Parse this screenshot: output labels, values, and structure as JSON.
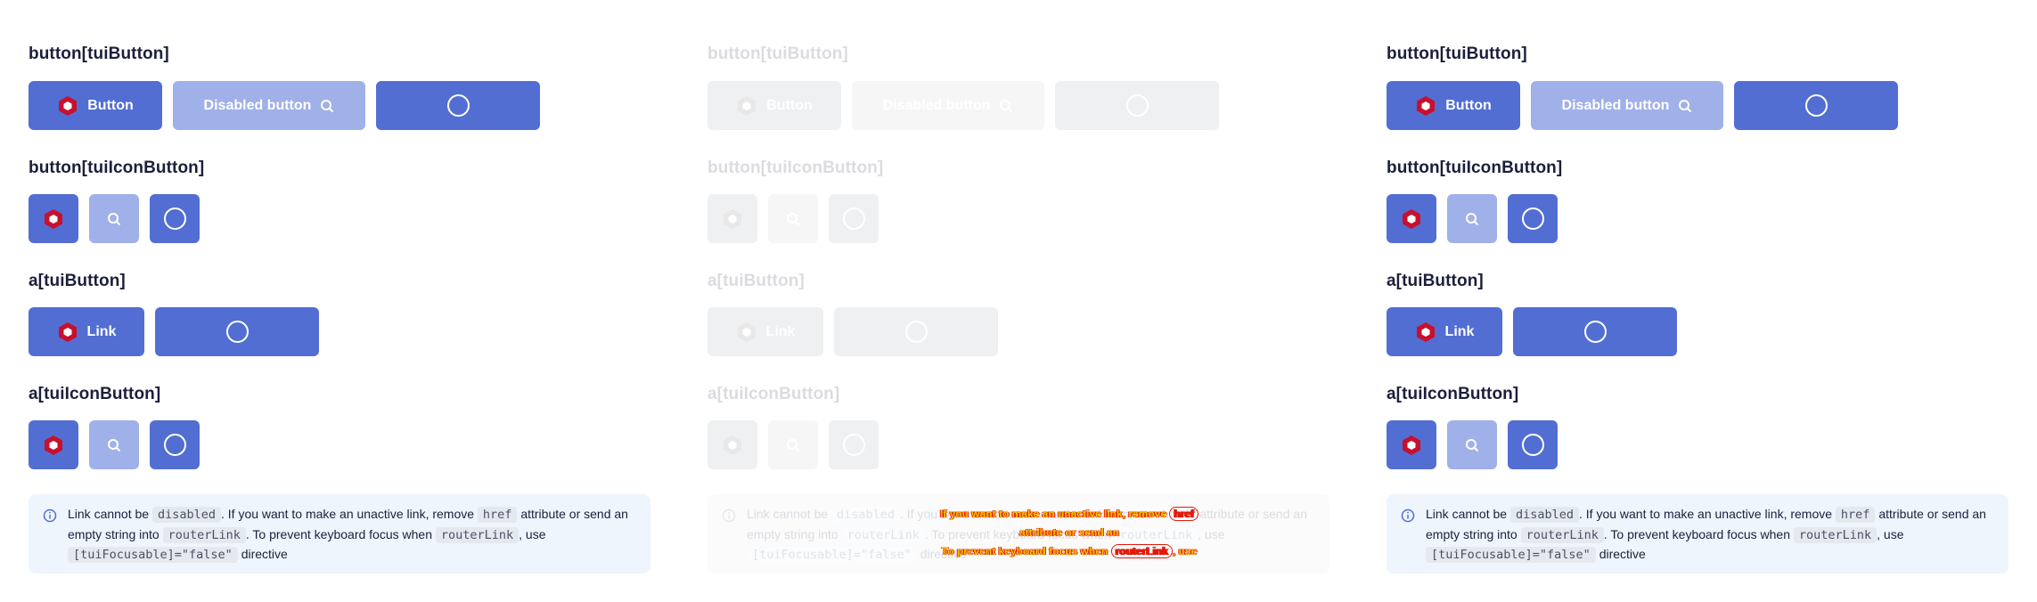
{
  "sections": {
    "button_tuiButton": "button[tuiButton]",
    "button_tuiIconButton": "button[tuiIconButton]",
    "a_tuiButton": "a[tuiButton]",
    "a_tuiIconButton": "a[tuiIconButton]"
  },
  "buttons": {
    "button_label": "Button",
    "disabled_label": "Disabled button",
    "link_label": "Link"
  },
  "notice": {
    "t1": "Link cannot be ",
    "c1": "disabled",
    "t2": ". If you want to make an unactive link, remove ",
    "c2": "href",
    "t3": " attribute or send an empty string into ",
    "c3": "routerLink",
    "t4": ". To prevent keyboard focus when ",
    "c4": "routerLink",
    "t5": ", use ",
    "c5": "[tuiFocusable]=\"false\"",
    "t6": " directive"
  },
  "overlay": {
    "line1": "If you want to make an unactive link, remove",
    "code1": "href",
    "line1b": "attribute or send an",
    "line2": "To prevent keyboard focus when",
    "code2": "routerLink",
    "line2b": ", use"
  },
  "colors": {
    "primary": "#526ed3",
    "primary_disabled": "#a0b0e8",
    "hex_icon": "#c8102e",
    "notice_bg": "#eef5fd"
  },
  "icons": [
    "hexagon-logo-icon",
    "search-icon",
    "circle-icon",
    "info-icon"
  ]
}
